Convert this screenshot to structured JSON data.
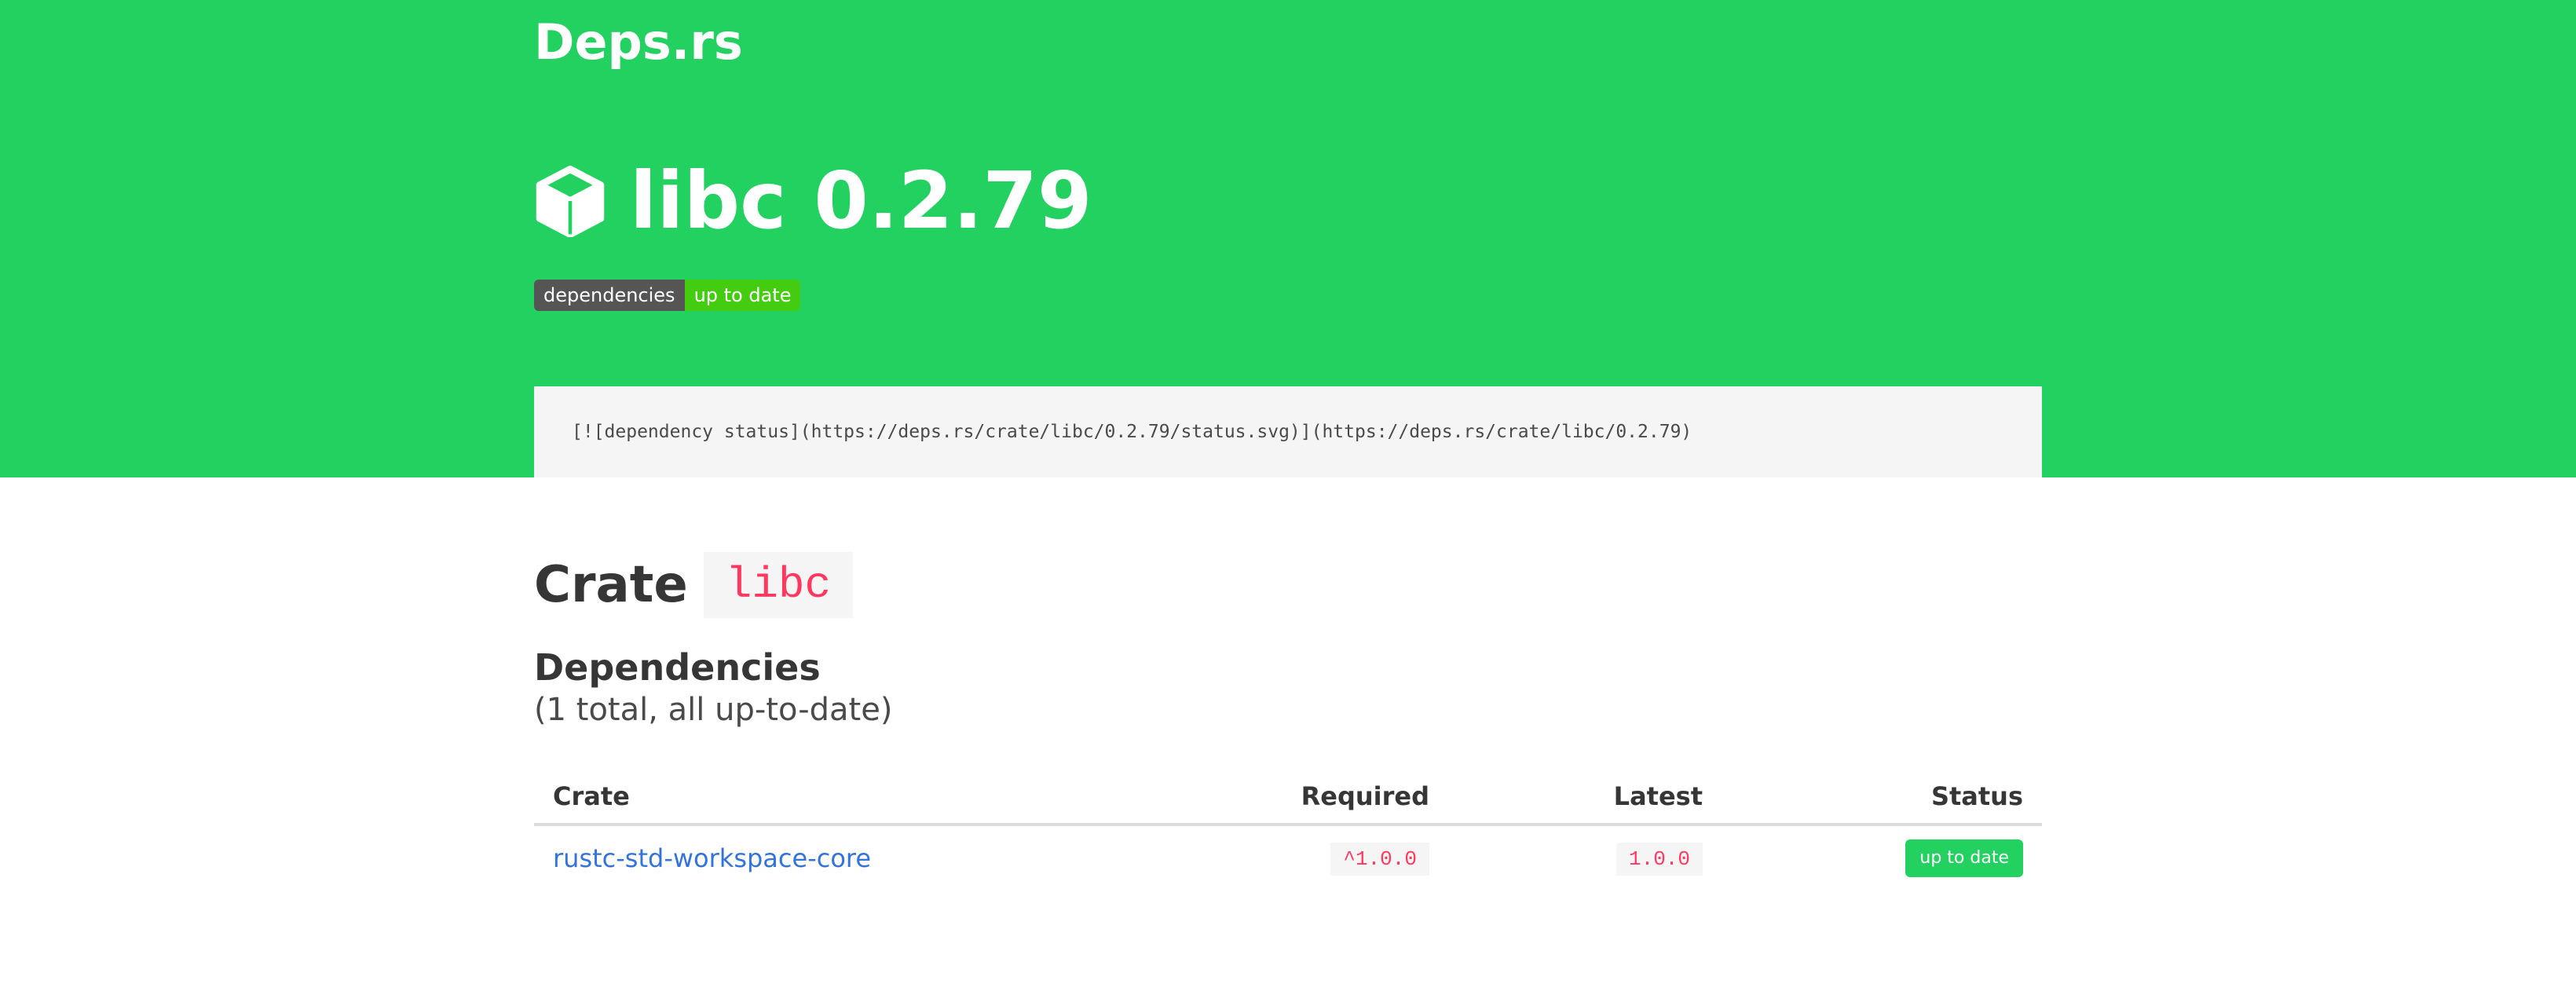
{
  "brand": "Deps.rs",
  "header": {
    "title": "libc 0.2.79",
    "icon": "cube-icon",
    "badge": {
      "left": "dependencies",
      "right": "up to date"
    }
  },
  "code_snippet": "[![dependency status](https://deps.rs/crate/libc/0.2.79/status.svg)](https://deps.rs/crate/libc/0.2.79)",
  "crate": {
    "label": "Crate",
    "name": "libc"
  },
  "dependencies": {
    "title": "Dependencies",
    "subtitle": "(1 total, all up-to-date)",
    "columns": [
      "Crate",
      "Required",
      "Latest",
      "Status"
    ],
    "rows": [
      {
        "crate": "rustc-std-workspace-core",
        "required": "^1.0.0",
        "latest": "1.0.0",
        "status": "up to date"
      }
    ]
  },
  "colors": {
    "hero": "#23d160",
    "link": "#3273dc",
    "code": "#ff3860"
  }
}
